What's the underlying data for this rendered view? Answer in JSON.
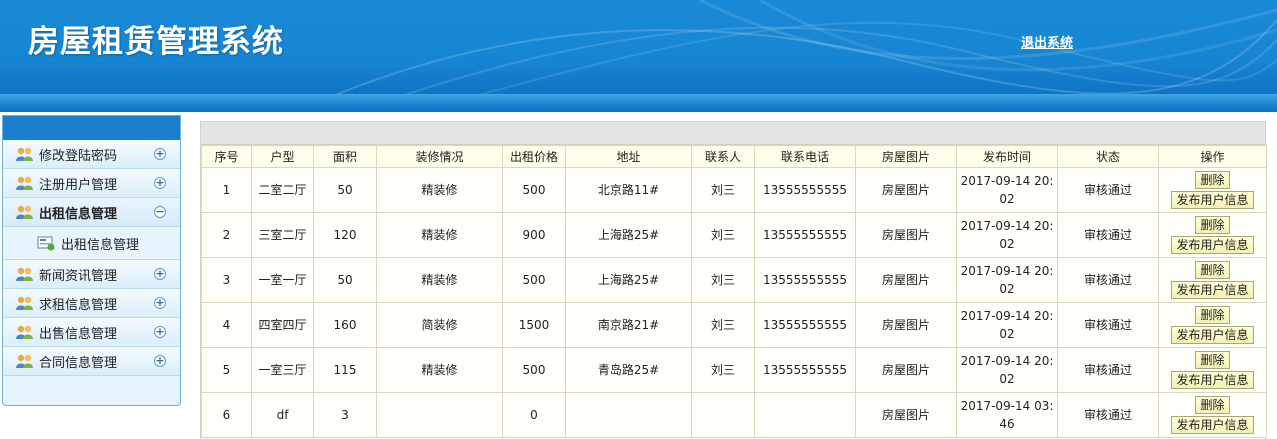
{
  "header": {
    "title": "房屋租赁管理系统",
    "logout_label": "退出系统"
  },
  "sidebar": {
    "items": [
      {
        "label": "修改登陆密码",
        "toggle": "+"
      },
      {
        "label": "注册用户管理",
        "toggle": "+"
      },
      {
        "label": "出租信息管理",
        "toggle": "−",
        "active": true
      },
      {
        "label": "新闻资讯管理",
        "toggle": "+"
      },
      {
        "label": "求租信息管理",
        "toggle": "+"
      },
      {
        "label": "出售信息管理",
        "toggle": "+"
      },
      {
        "label": "合同信息管理",
        "toggle": "+"
      }
    ],
    "submenu": {
      "label": "出租信息管理"
    }
  },
  "table": {
    "columns": [
      "序号",
      "户型",
      "面积",
      "装修情况",
      "出租价格",
      "地址",
      "联系人",
      "联系电话",
      "房屋图片",
      "发布时间",
      "状态",
      "操作"
    ],
    "delete_label": "删除",
    "publish_label": "发布用户信息",
    "rows": [
      {
        "id": "1",
        "type": "二室二厅",
        "area": "50",
        "decor": "精装修",
        "price": "500",
        "address": "北京路11#",
        "contact": "刘三",
        "phone": "13555555555",
        "image": "房屋图片",
        "time": "2017-09-14 20:02",
        "status": "审核通过"
      },
      {
        "id": "2",
        "type": "三室二厅",
        "area": "120",
        "decor": "精装修",
        "price": "900",
        "address": "上海路25#",
        "contact": "刘三",
        "phone": "13555555555",
        "image": "房屋图片",
        "time": "2017-09-14 20:02",
        "status": "审核通过"
      },
      {
        "id": "3",
        "type": "一室一厅",
        "area": "50",
        "decor": "精装修",
        "price": "500",
        "address": "上海路25#",
        "contact": "刘三",
        "phone": "13555555555",
        "image": "房屋图片",
        "time": "2017-09-14 20:02",
        "status": "审核通过"
      },
      {
        "id": "4",
        "type": "四室四厅",
        "area": "160",
        "decor": "简装修",
        "price": "1500",
        "address": "南京路21#",
        "contact": "刘三",
        "phone": "13555555555",
        "image": "房屋图片",
        "time": "2017-09-14 20:02",
        "status": "审核通过"
      },
      {
        "id": "5",
        "type": "一室三厅",
        "area": "115",
        "decor": "精装修",
        "price": "500",
        "address": "青岛路25#",
        "contact": "刘三",
        "phone": "13555555555",
        "image": "房屋图片",
        "time": "2017-09-14 20:02",
        "status": "审核通过"
      },
      {
        "id": "6",
        "type": "df",
        "area": "3",
        "decor": "",
        "price": "0",
        "address": "",
        "contact": "",
        "phone": "",
        "image": "房屋图片",
        "time": "2017-09-14 03:46",
        "status": "审核通过"
      }
    ]
  }
}
